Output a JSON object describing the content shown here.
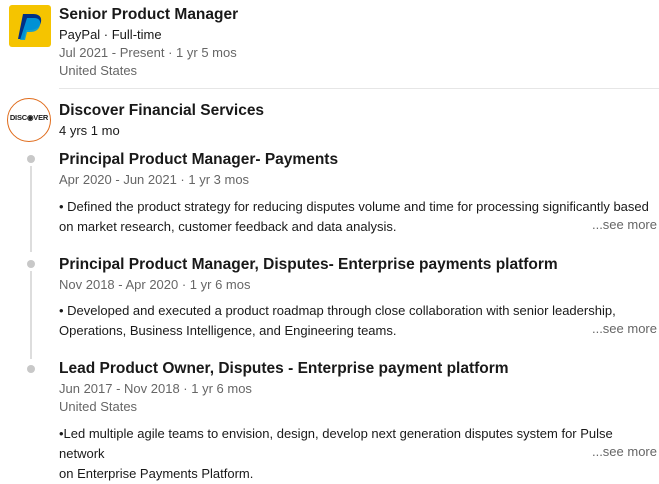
{
  "experience": {
    "paypal": {
      "role": "Senior Product Manager",
      "company_line": "PayPal · Full-time",
      "dates": "Jul 2021 - Present · 1 yr 5 mos",
      "location": "United States",
      "logo_color": "#f5c400"
    },
    "discover": {
      "company": "Discover Financial Services",
      "tenure": "4 yrs 1 mo",
      "logo_text": "DISC◉VER",
      "accent_color": "#e06c1c",
      "roles": [
        {
          "title": "Principal Product Manager- Payments",
          "dates": "Apr 2020 - Jun 2021 · 1 yr 3 mos",
          "desc_line1": "• Defined the product strategy for reducing disputes volume and time for processing significantly based",
          "desc_line2": "on market research, customer feedback and data analysis.",
          "see_more": "...see more"
        },
        {
          "title": "Principal Product Manager, Disputes- Enterprise payments platform",
          "dates": "Nov 2018 - Apr 2020 · 1 yr 6 mos",
          "desc_line1": "• Developed and executed a product roadmap through close collaboration with senior leadership,",
          "desc_line2": "Operations, Business Intelligence, and Engineering teams.",
          "see_more": "...see more"
        },
        {
          "title": "Lead Product Owner, Disputes - Enterprise payment platform",
          "dates": "Jun 2017 - Nov 2018 · 1 yr 6 mos",
          "location": "United States",
          "desc_line1": "•Led multiple agile teams to envision, design, develop next generation disputes system for Pulse network",
          "desc_line2": "on Enterprise Payments Platform.",
          "see_more": "...see more"
        }
      ]
    }
  }
}
